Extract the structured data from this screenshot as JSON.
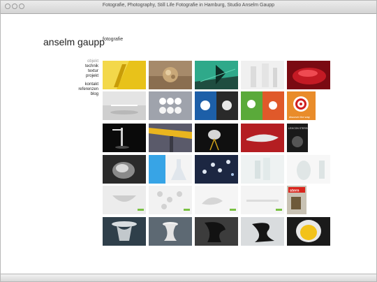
{
  "window": {
    "title": "Fotografie, Photography, Still Life Fotografie in Hamburg, Studio Anselm Gaupp"
  },
  "site": {
    "name": "anselm gaupp",
    "tagline": "fotografie"
  },
  "nav": {
    "primary": [
      "objekt",
      "technik",
      "textur",
      "projekt"
    ],
    "secondary": [
      "kontakt",
      "referenzen",
      "blog"
    ],
    "active": "objekt"
  },
  "gallery": {
    "rows": 6,
    "columns": 5,
    "count": 30
  },
  "thumb_texts": {
    "r2c5": "discover the way",
    "r4c5": "LEXICON STEREO",
    "r5c5": "stern"
  }
}
